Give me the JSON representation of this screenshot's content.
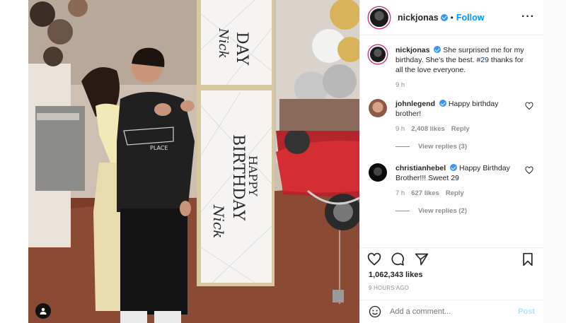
{
  "post": {
    "username": "nickjonas",
    "follow_label": "Follow",
    "separator": "•",
    "more_label": "···",
    "caption_text": "She surprised me for my birthday. She's the best. ",
    "caption_hashtag": "#29",
    "caption_tail": " thanks for all the love everyone.",
    "caption_time": "9 h",
    "likes": "1,062,343 likes",
    "time_ago": "9 HOURS AGO"
  },
  "photo": {
    "banner_top_text": "DAY",
    "banner_top_script": "Nick",
    "banner_main_text_1": "HAPPY",
    "banner_main_text_2": "BIRTHDAY",
    "banner_main_script": "Nick",
    "shirt_text": "PLACE"
  },
  "comments": [
    {
      "username": "johnlegend",
      "text": "Happy birthday brother!",
      "time": "9 h",
      "likes": "2,408 likes",
      "reply_label": "Reply",
      "view_replies": "View replies (3)"
    },
    {
      "username": "christianhebel",
      "text": "Happy Birthday Brother!!! Sweet 29",
      "time": "7 h",
      "likes": "627 likes",
      "reply_label": "Reply",
      "view_replies": "View replies (2)"
    }
  ],
  "composer": {
    "placeholder": "Add a comment...",
    "post_label": "Post"
  },
  "icons": {
    "like": "heart-icon",
    "comment": "comment-icon",
    "share": "share-icon",
    "save": "bookmark-icon",
    "emoji": "emoji-icon",
    "user_tag": "user-tag-icon"
  },
  "colors": {
    "link_blue": "#0095f6",
    "verified_blue": "#3897f0",
    "muted_text": "#8e8e8e",
    "post_disabled": "#b2dffc"
  }
}
